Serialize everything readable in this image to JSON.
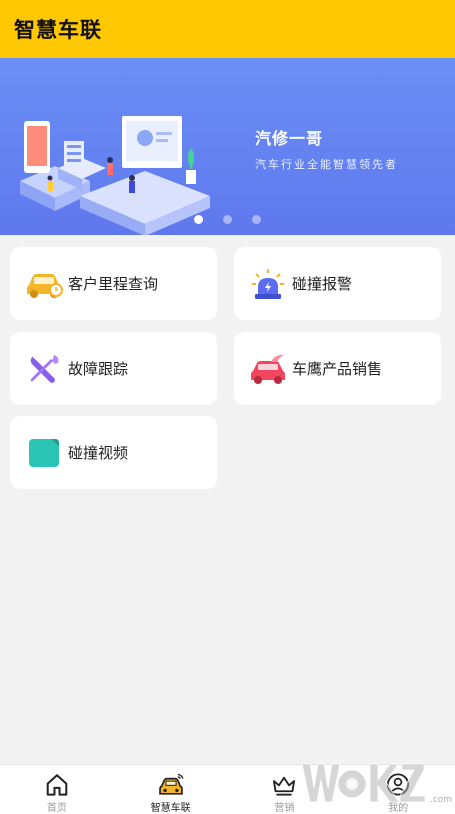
{
  "header": {
    "title": "智慧车联"
  },
  "banner": {
    "title": "汽修一哥",
    "subtitle": "汽车行业全能智慧领先者",
    "page_indicator": {
      "count": 3,
      "active": 1
    }
  },
  "menu": {
    "items": [
      {
        "label": "客户里程查询",
        "icon": "car-mileage-icon",
        "color": "#f5b52a"
      },
      {
        "label": "碰撞报警",
        "icon": "siren-icon",
        "color": "#5a6df0"
      },
      {
        "label": "故障跟踪",
        "icon": "tools-icon",
        "color": "#8a5cf0"
      },
      {
        "label": "车鹰产品销售",
        "icon": "car-sale-icon",
        "color": "#f0475f"
      },
      {
        "label": "碰撞视频",
        "icon": "video-icon",
        "color": "#2bc5b6"
      }
    ]
  },
  "tabbar": {
    "tabs": [
      {
        "label": "首页",
        "icon": "home-icon",
        "active": false
      },
      {
        "label": "智慧车联",
        "icon": "car-connect-icon",
        "active": true
      },
      {
        "label": "营销",
        "icon": "crown-icon",
        "active": false
      },
      {
        "label": "我的",
        "icon": "user-icon",
        "active": false
      }
    ]
  },
  "colors": {
    "brand_yellow": "#ffc800",
    "banner_blue": "#6a8ff4",
    "background": "#f2f2f2"
  }
}
